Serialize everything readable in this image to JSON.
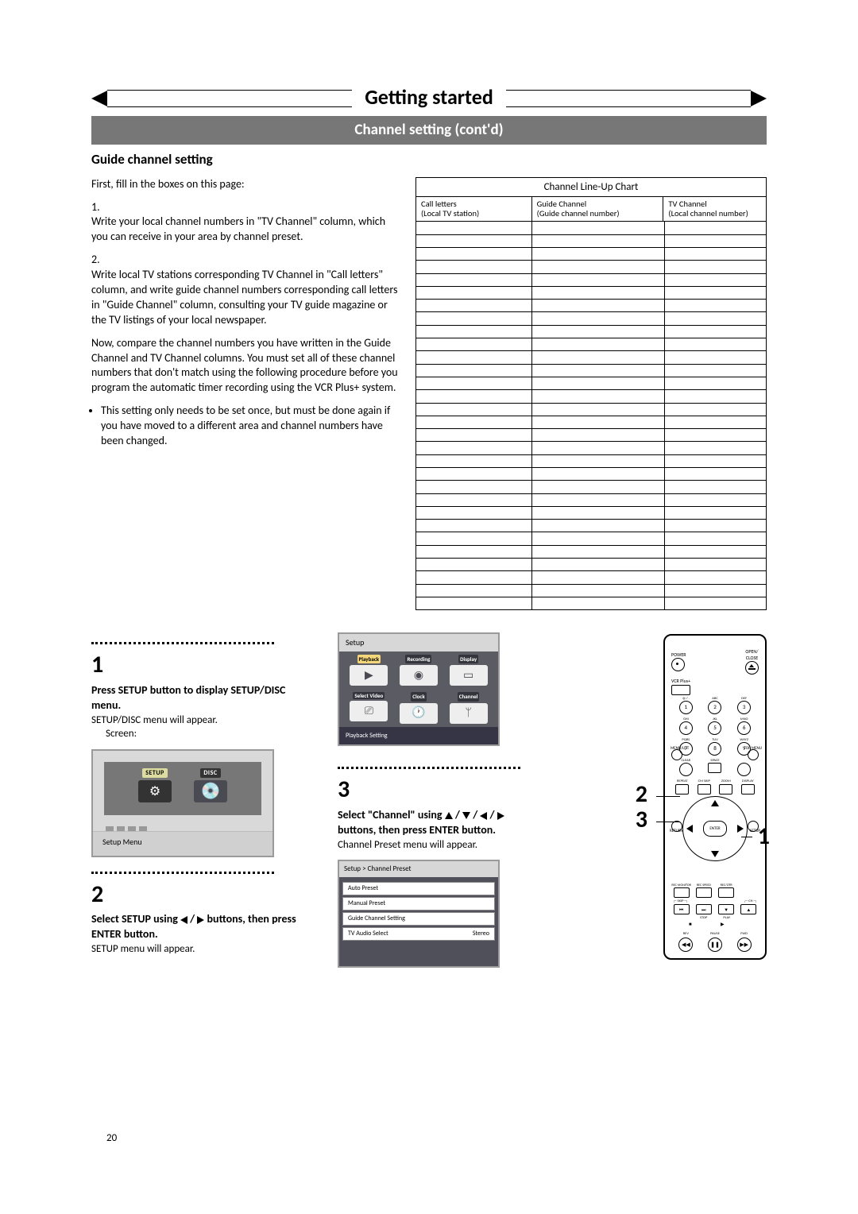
{
  "header": {
    "title": "Getting started"
  },
  "subheader": "Channel setting (cont'd)",
  "section_title": "Guide channel setting",
  "intro": "First, fill in the boxes on this page:",
  "p1_num": "1.",
  "p1": "Write your local channel numbers in \"TV Channel\" column, which you can receive in your area by channel preset.",
  "p2_num": "2.",
  "p2": "Write local TV stations corresponding TV Channel in \"Call letters\" column, and write guide channel numbers corresponding call letters in \"Guide Channel\" column, consulting your TV guide magazine or the TV listings of your local newspaper.",
  "p3": "Now, compare the channel numbers you have written in the Guide Channel and TV Channel columns. You must set all of these channel numbers that don't match using the following procedure before you program the automatic timer recording using the VCR Plus+ system.",
  "bullet": "This setting only needs to be set once, but must be done again if you have moved to a different area and channel numbers have been changed.",
  "lineup": {
    "title": "Channel Line-Up Chart",
    "h1a": "Call letters",
    "h1b": "(Local TV station)",
    "h2a": "Guide Channel",
    "h2b": "(Guide channel number)",
    "h3a": "TV Channel",
    "h3b": "(Local channel number)",
    "rows": 30
  },
  "steps": {
    "s1": {
      "num": "1",
      "bold": "Press SETUP button to display SETUP/DISC menu.",
      "text": "SETUP/DISC menu will appear.",
      "screen": "Screen:"
    },
    "s2": {
      "num": "2",
      "bold_pre": "Select SETUP using ",
      "bold_post": " buttons, then press ENTER button.",
      "text": "SETUP menu will appear."
    },
    "s3": {
      "num": "3",
      "bold_pre": "Select \"Channel\" using ",
      "bold_mid": " / ",
      "bold_post": " buttons, then press ENTER button.",
      "text": "Channel Preset menu will appear."
    }
  },
  "mini_window": {
    "labels": {
      "setup": "SETUP",
      "disc": "DISC"
    },
    "caption": "Setup Menu"
  },
  "grid6": {
    "title": "Setup",
    "items": [
      "Playback",
      "Recording",
      "Display",
      "Select Video",
      "Clock",
      "Channel"
    ],
    "footer": "Playback Setting"
  },
  "preset": {
    "title": "Setup > Channel Preset",
    "items": [
      "Auto Preset",
      "Manual Preset",
      "Guide Channel Setting",
      "TV Audio Select"
    ],
    "right": [
      "",
      "",
      "",
      "Stereo"
    ]
  },
  "remote": {
    "power": "POWER",
    "open": "OPEN/\nCLOSE",
    "vcrplus": "VCR Plus+",
    "keypad_labels": [
      "",
      "@ / .",
      "ABC",
      "DEF",
      "GHI",
      "JKL",
      "MNO",
      "PQRS",
      "TUV",
      "WXYZ",
      "CLEAR",
      "SPACE"
    ],
    "keypad_nums": [
      "",
      "1",
      "2",
      "3",
      "4",
      "5",
      "6",
      "7",
      "8",
      "9",
      "",
      "0"
    ],
    "row4": [
      "REPEAT",
      "CM SKIP",
      "ZOOM",
      "DISPLAY"
    ],
    "menulist": "MENU/LIST",
    "topmenu": "TOP MENU",
    "enter": "ENTER",
    "return": "RETURN",
    "setup": "SETUP",
    "bot_row1": [
      "REC MONITOR",
      "REC SPEED",
      "REC/OTR",
      ""
    ],
    "bot_skip": "SKIP",
    "bot_ch": "CH",
    "bot_stop": "STOP",
    "bot_play": "PLAY",
    "rev": "REV",
    "fwd": "FWD",
    "pause": "PAUSE"
  },
  "callouts": {
    "c1": "1",
    "c2": "2",
    "c3": "3"
  },
  "page_number": "20"
}
